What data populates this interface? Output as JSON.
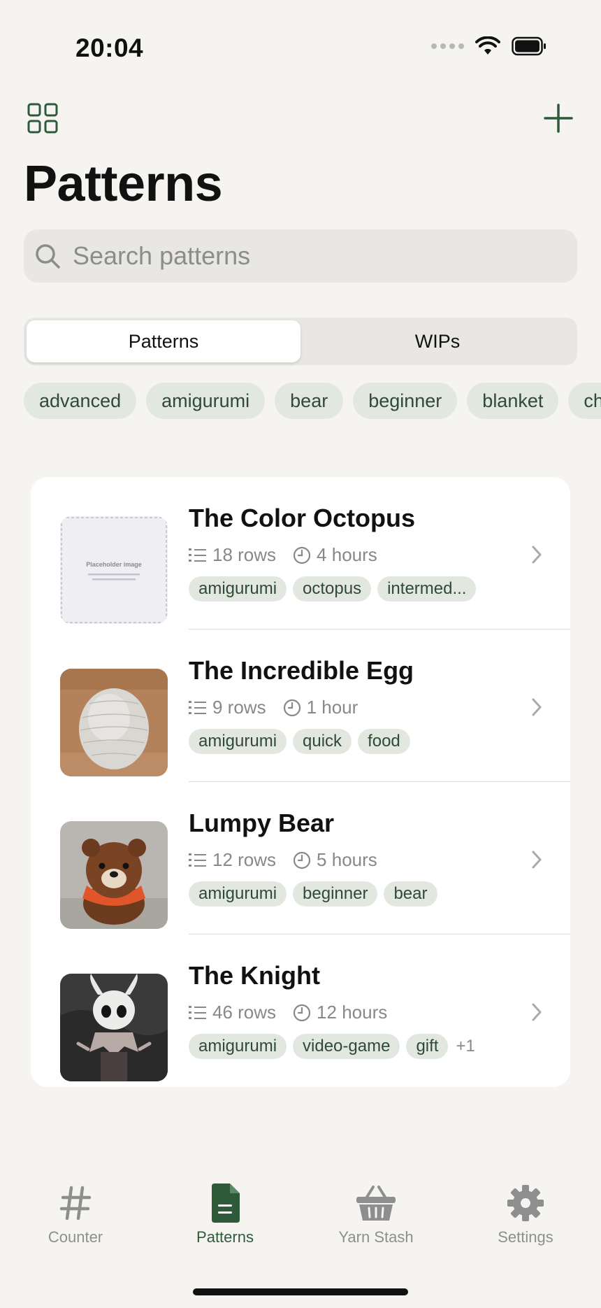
{
  "status_bar": {
    "time": "20:04"
  },
  "header": {
    "title": "Patterns"
  },
  "search": {
    "placeholder": "Search patterns"
  },
  "segments": [
    {
      "label": "Patterns",
      "active": true
    },
    {
      "label": "WIPs",
      "active": false
    }
  ],
  "filter_tags": [
    "advanced",
    "amigurumi",
    "bear",
    "beginner",
    "blanket",
    "ch"
  ],
  "patterns": [
    {
      "title": "The Color Octopus",
      "rows": "18 rows",
      "time": "4 hours",
      "tags": [
        "amigurumi",
        "octopus",
        "intermed..."
      ],
      "more": "",
      "thumb_label": "Placeholder image"
    },
    {
      "title": "The Incredible Egg",
      "rows": "9 rows",
      "time": "1 hour",
      "tags": [
        "amigurumi",
        "quick",
        "food"
      ],
      "more": ""
    },
    {
      "title": "Lumpy Bear",
      "rows": "12 rows",
      "time": "5 hours",
      "tags": [
        "amigurumi",
        "beginner",
        "bear"
      ],
      "more": ""
    },
    {
      "title": "The Knight",
      "rows": "46 rows",
      "time": "12 hours",
      "tags": [
        "amigurumi",
        "video-game",
        "gift"
      ],
      "more": "+1"
    }
  ],
  "tab_bar": [
    {
      "label": "Counter",
      "icon": "hash-icon",
      "active": false
    },
    {
      "label": "Patterns",
      "icon": "document-icon",
      "active": true
    },
    {
      "label": "Yarn Stash",
      "icon": "basket-icon",
      "active": false
    },
    {
      "label": "Settings",
      "icon": "gear-icon",
      "active": false
    }
  ],
  "colors": {
    "accent": "#2f5a3a",
    "tag_bg": "#e2e7df",
    "background": "#f5f4f0"
  }
}
